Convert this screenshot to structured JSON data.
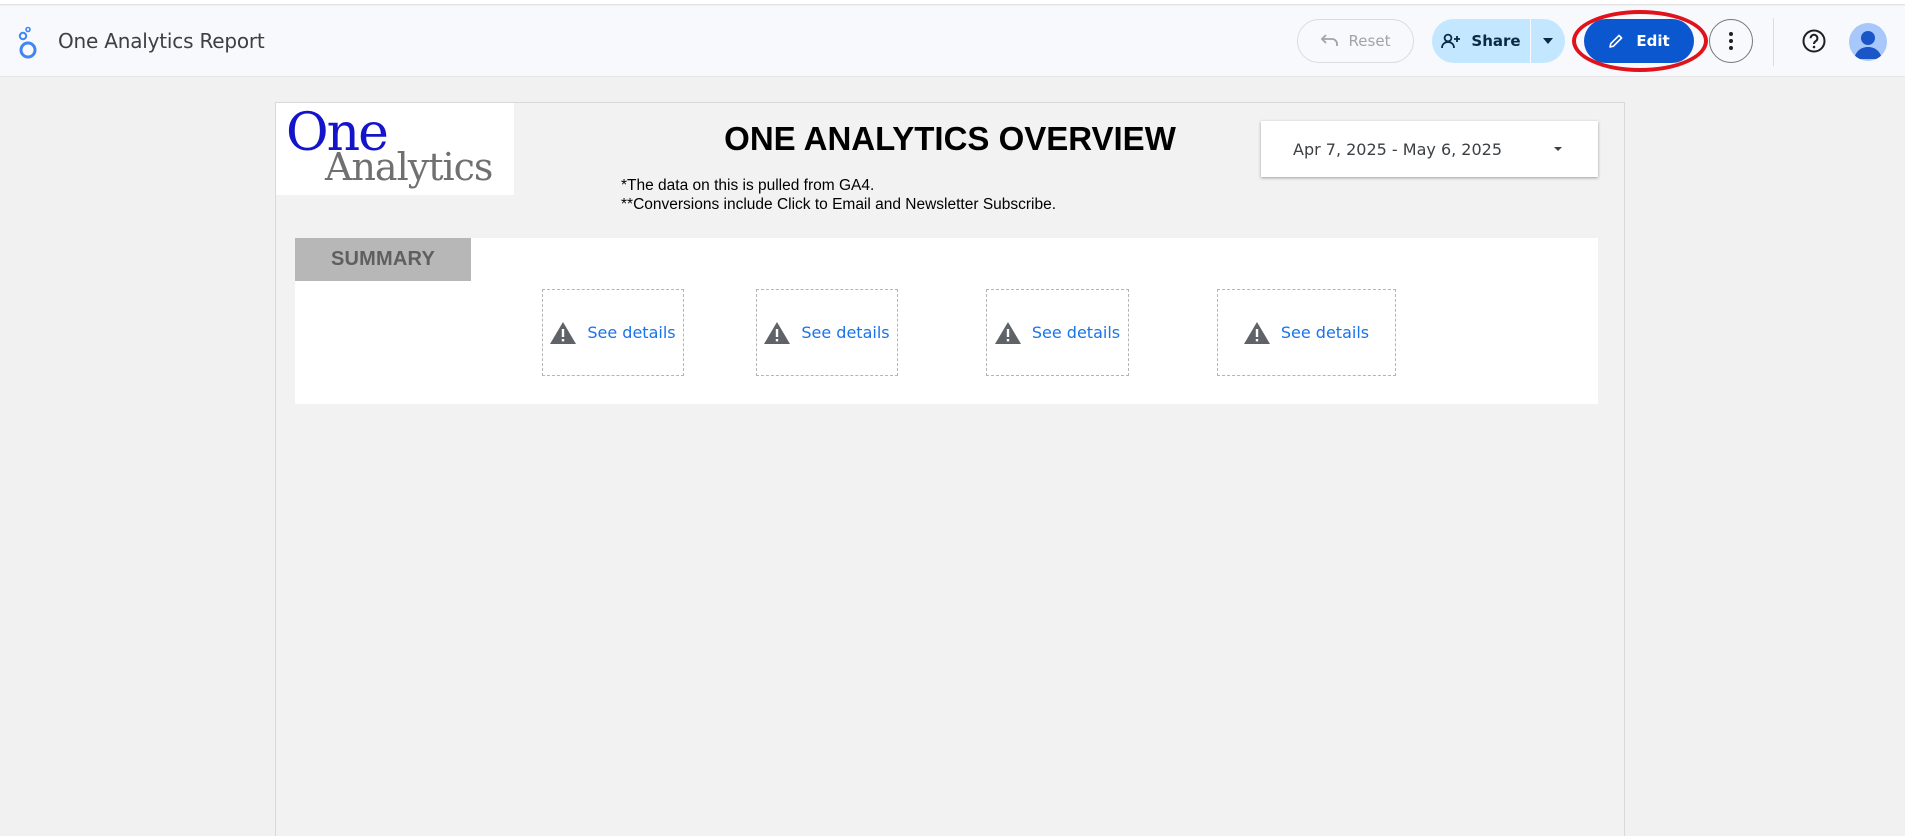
{
  "header": {
    "app_title": "One Analytics Report",
    "reset_label": "Reset",
    "share_label": "Share",
    "edit_label": "Edit"
  },
  "report": {
    "logo_line1": "One",
    "logo_line2": "Analytics",
    "title": "ONE ANALYTICS OVERVIEW",
    "note1": "*The data on this is pulled from GA4.",
    "note2": "**Conversions include Click to Email and Newsletter Subscribe.",
    "date_range": "Apr 7, 2025 - May 6, 2025",
    "summary_label": "SUMMARY",
    "cards": [
      {
        "link": "See details"
      },
      {
        "link": "See details"
      },
      {
        "link": "See details"
      },
      {
        "link": "See details"
      }
    ]
  },
  "icons": {
    "app_logo": "looker-studio-logo-icon",
    "reset": "undo-icon",
    "share": "person-add-icon",
    "share_dropdown": "caret-down-icon",
    "edit": "pencil-icon",
    "more": "more-vert-icon",
    "help": "help-circle-icon",
    "avatar": "account-icon",
    "card_error": "warning-triangle-icon"
  },
  "colors": {
    "edit_button": "#0b57d0",
    "share_button": "#c2e7ff",
    "annotation_ring": "#e0121b",
    "link": "#1a73e8",
    "logo_blue": "#1414c8"
  }
}
